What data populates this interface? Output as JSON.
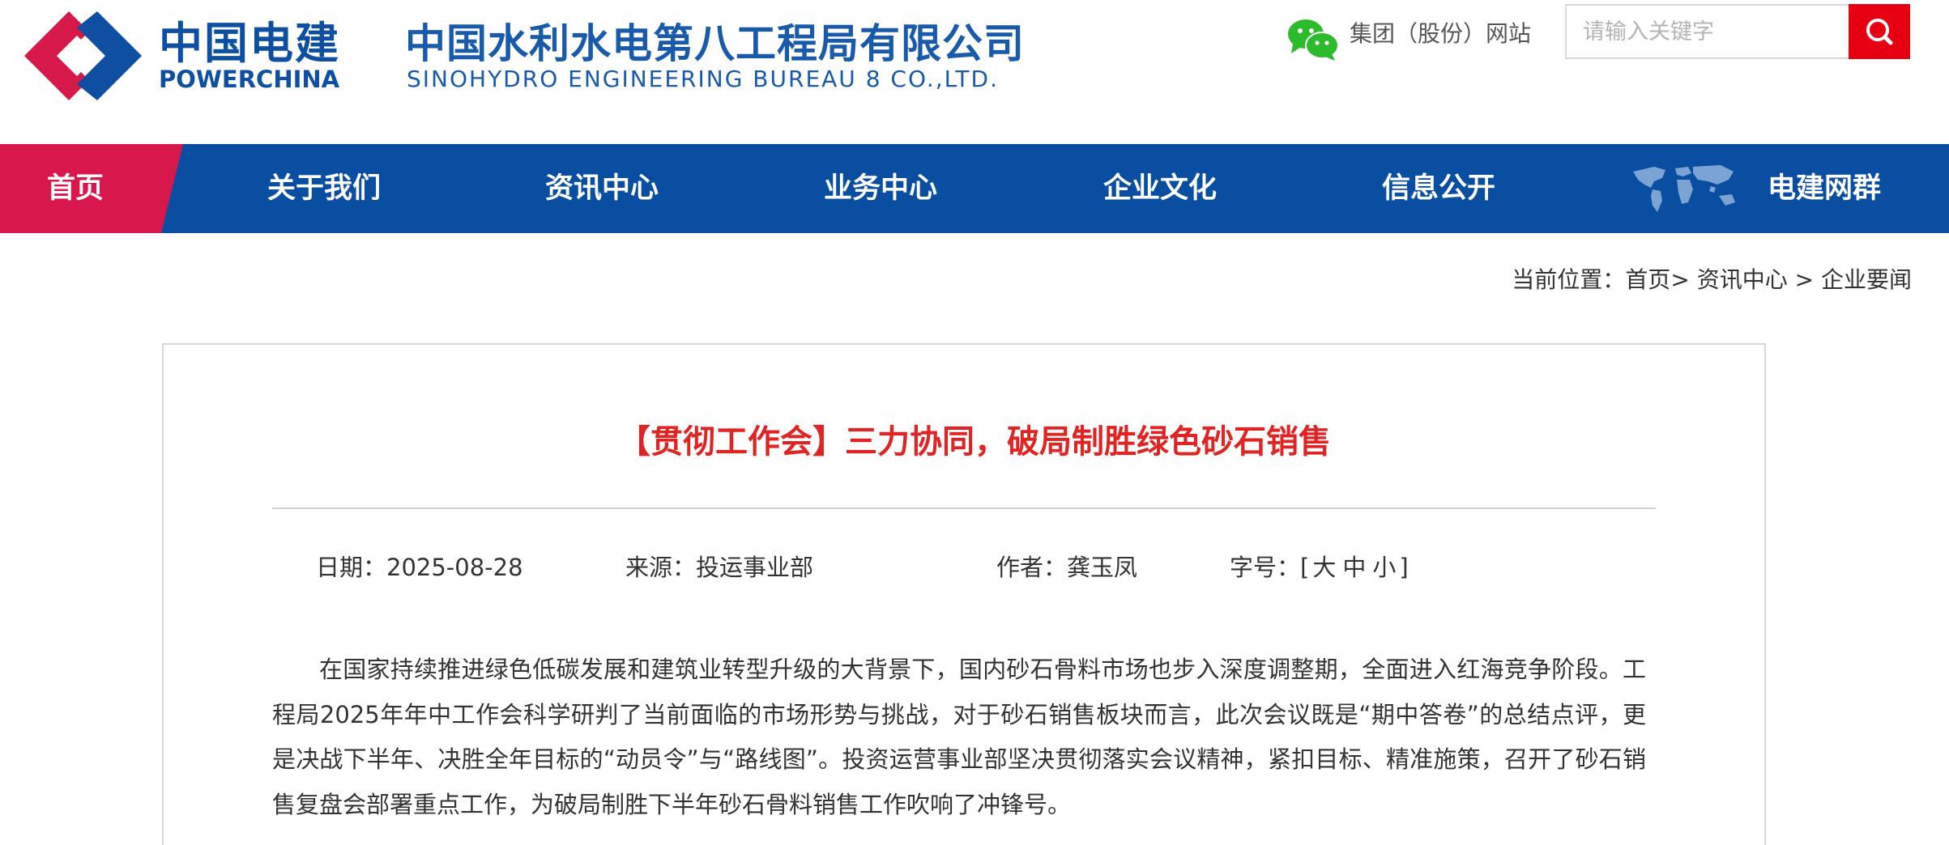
{
  "header": {
    "brand_cn": "中国电建",
    "brand_en": "POWERCHINA",
    "company_cn": "中国水利水电第八工程局有限公司",
    "company_en": "SINOHYDRO ENGINEERING BUREAU 8 CO.,LTD.",
    "group_link": "集团（股份）网站",
    "search": {
      "placeholder": "请输入关键字"
    },
    "icons": {
      "wechat": "wechat-icon",
      "search": "search-icon",
      "logo": "powerchina-logo"
    }
  },
  "nav": {
    "items": [
      {
        "label": "首页",
        "active": true
      },
      {
        "label": "关于我们"
      },
      {
        "label": "资讯中心"
      },
      {
        "label": "业务中心"
      },
      {
        "label": "企业文化"
      },
      {
        "label": "信息公开"
      },
      {
        "label": "电建网群"
      }
    ]
  },
  "breadcrumb": {
    "prefix": "当前位置：",
    "items": [
      "首页",
      "资讯中心",
      "企业要闻"
    ],
    "separators": [
      ">",
      ">"
    ]
  },
  "article": {
    "title": "【贯彻工作会】三力协同，破局制胜绿色砂石销售",
    "date": "日期：2025-08-28",
    "source": "来源：投运事业部",
    "author": "作者：龚玉凤",
    "fontsize_label": "字号：[",
    "fontsize_options": [
      "大",
      "中",
      "小"
    ],
    "fontsize_close": "]",
    "paragraph": "在国家持续推进绿色低碳发展和建筑业转型升级的大背景下，国内砂石骨料市场也步入深度调整期，全面进入红海竞争阶段。工程局2025年年中工作会科学研判了当前面临的市场形势与挑战，对于砂石销售板块而言，此次会议既是“期中答卷”的总结点评，更是决战下半年、决胜全年目标的“动员令”与“路线图”。投资运营事业部坚决贯彻落实会议精神，紧扣目标、精准施策，召开了砂石销售复盘会部署重点工作，为破局制胜下半年砂石骨料销售工作吹响了冲锋号。"
  },
  "colors": {
    "brand_blue": "#0a4ea1",
    "home_red": "#d8184d",
    "search_red": "#e60012",
    "title_red": "#e02424"
  }
}
